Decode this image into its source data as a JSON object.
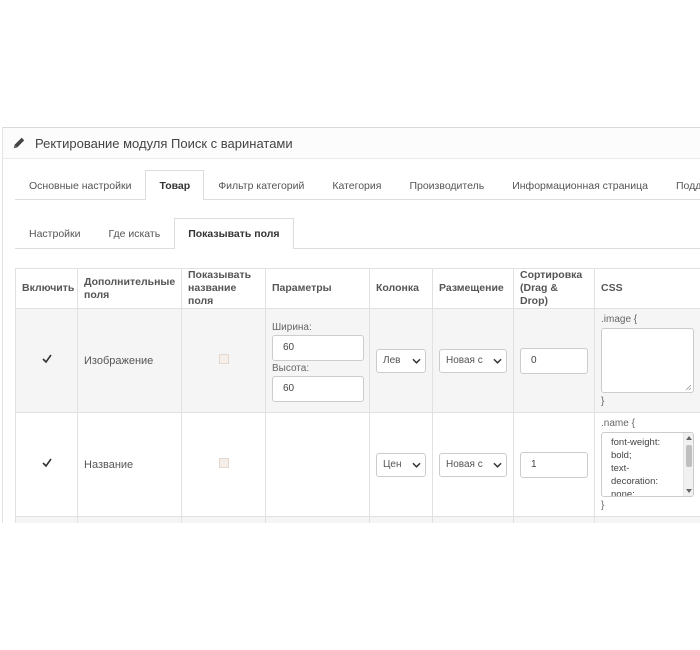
{
  "panel": {
    "title": "Ректирование модуля Поиск с варинатами"
  },
  "main_tabs": [
    "Основные настройки",
    "Товар",
    "Фильтр категорий",
    "Категория",
    "Производитель",
    "Информационная страница",
    "Поддержка"
  ],
  "main_tabs_active": "Товар",
  "sub_tabs": [
    "Настройки",
    "Где искать",
    "Показывать поля"
  ],
  "sub_tabs_active": "Показывать поля",
  "table": {
    "headers": {
      "enable": "Включить",
      "extra_fields": "Дополнительные поля",
      "show_name": "Показывать название поля",
      "params": "Параметры",
      "column": "Колонка",
      "placement": "Размещение",
      "sort": "Сортировка (Drag & Drop)",
      "css": "CSS"
    },
    "rows": [
      {
        "enabled": true,
        "field": "Изображение",
        "width_label": "Ширина:",
        "width_value": "60",
        "height_label": "Высота:",
        "height_value": "60",
        "column": "Лев",
        "placement": "Новая с",
        "sort": "0",
        "css_open": ".image {",
        "css_body": "",
        "css_close": "}"
      },
      {
        "enabled": true,
        "field": "Название",
        "column": "Цен",
        "placement": "Новая с",
        "sort": "1",
        "css_open": ".name {",
        "css_body_lines": [
          "font-weight:",
          "bold;",
          "text-",
          "decoration:",
          "none;"
        ],
        "css_close": "}"
      }
    ]
  }
}
